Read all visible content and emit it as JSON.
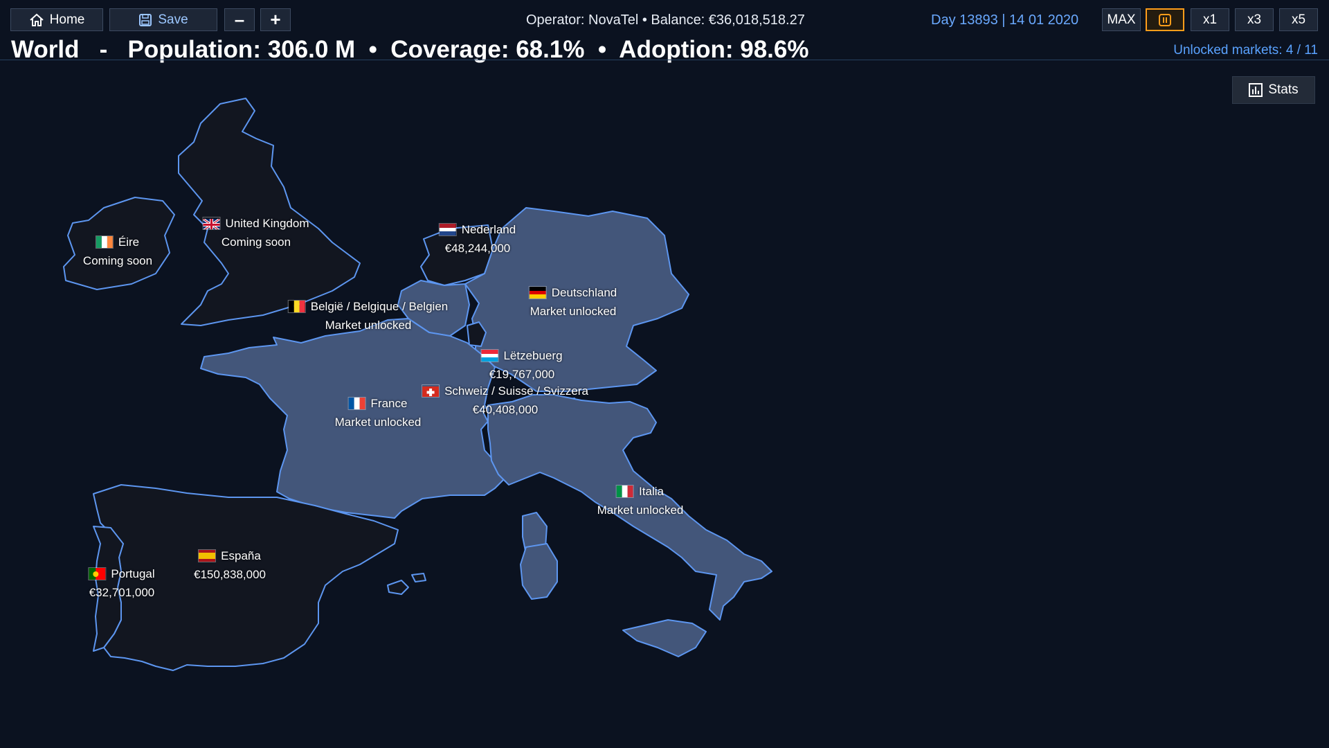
{
  "topbar": {
    "home_label": "Home",
    "save_label": "Save",
    "zoom_out_label": "–",
    "zoom_in_label": "+",
    "status": "Operator: NovaTel  •  Balance: €36,018,518.27",
    "day_date": "Day 13893  |  14 01 2020",
    "speeds": [
      "MAX",
      "x1",
      "x3",
      "x5"
    ],
    "active_control": "pause"
  },
  "header": {
    "summary": "World   -   Population: 306.0 M  •  Coverage: 68.1%  •  Adoption: 98.6%",
    "unlocked_markets": "Unlocked markets: 4 / 11"
  },
  "stats_button": {
    "label": "Stats"
  },
  "colors": {
    "background": "#0b1220",
    "locked_fill": "#121620",
    "unlocked_fill": "#43567a",
    "border": "#5d96f0",
    "accent": "#6aa9ff",
    "active_button": "#ff9d1a"
  },
  "countries": [
    {
      "id": "ie",
      "name": "Éire",
      "status": "Coming soon",
      "state": "locked"
    },
    {
      "id": "uk",
      "name": "United Kingdom",
      "status": "Coming soon",
      "state": "locked"
    },
    {
      "id": "nl",
      "name": "Nederland",
      "status": "€48,244,000",
      "state": "locked"
    },
    {
      "id": "be",
      "name": "België / Belgique / Belgien",
      "status": "Market unlocked",
      "state": "unlocked"
    },
    {
      "id": "de",
      "name": "Deutschland",
      "status": "Market unlocked",
      "state": "unlocked"
    },
    {
      "id": "lu",
      "name": "Lëtzebuerg",
      "status": "€19,767,000",
      "state": "locked"
    },
    {
      "id": "ch",
      "name": "Schweiz / Suisse / Svizzera",
      "status": "€40,408,000",
      "state": "locked"
    },
    {
      "id": "fr",
      "name": "France",
      "status": "Market unlocked",
      "state": "unlocked"
    },
    {
      "id": "it",
      "name": "Italia",
      "status": "Market unlocked",
      "state": "unlocked"
    },
    {
      "id": "es",
      "name": "España",
      "status": "€150,838,000",
      "state": "locked"
    },
    {
      "id": "pt",
      "name": "Portugal",
      "status": "€32,701,000",
      "state": "locked"
    }
  ]
}
